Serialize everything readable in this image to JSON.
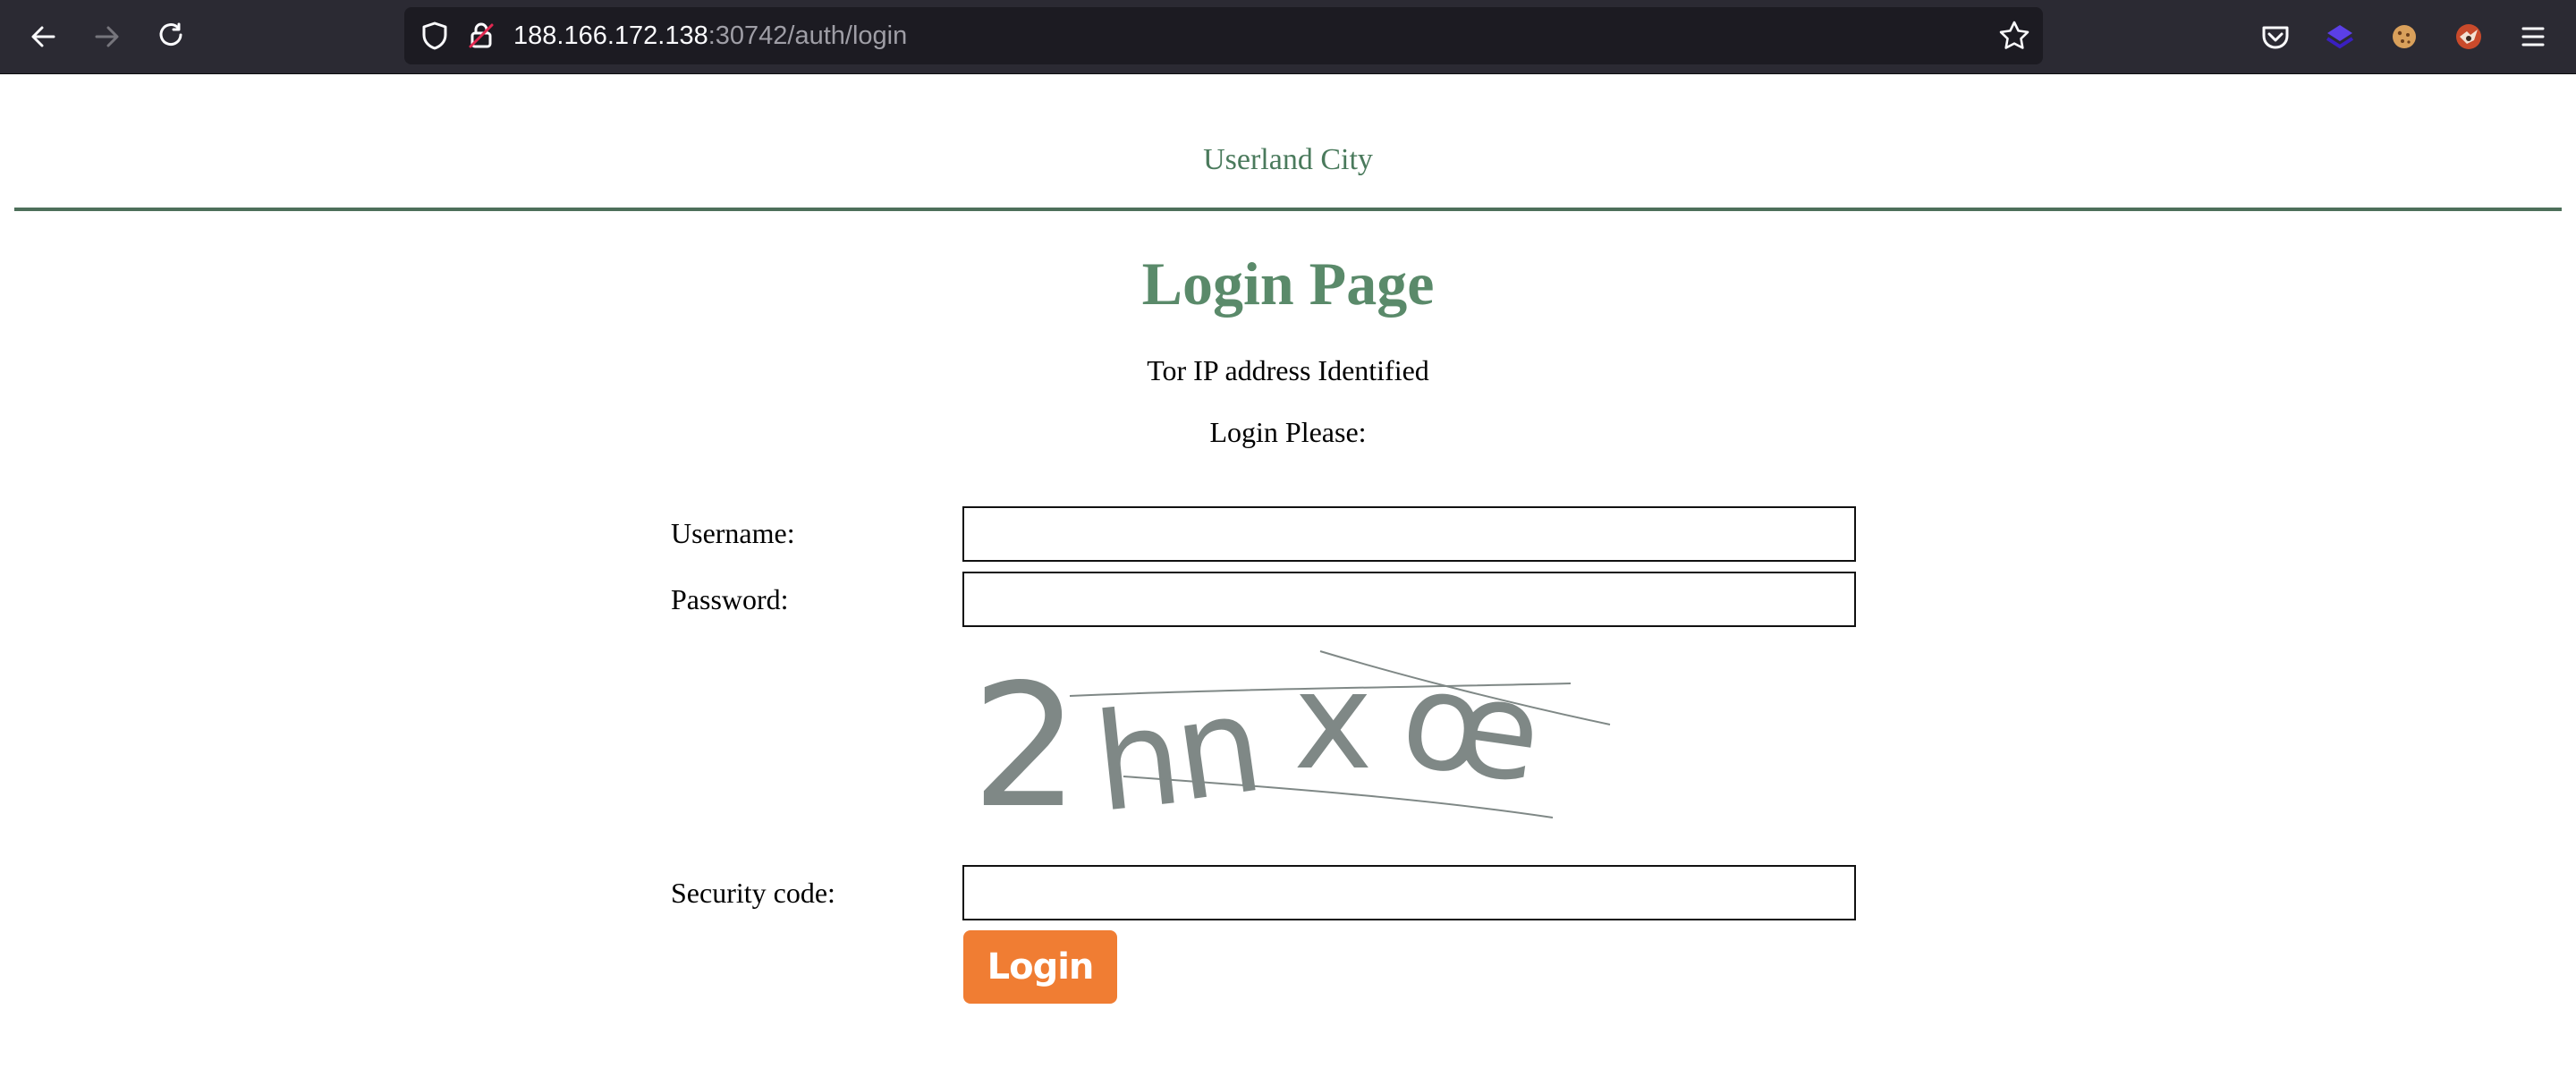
{
  "browser": {
    "url_host": "188.166.172.138",
    "url_path": ":30742/auth/login",
    "icons": [
      "back-arrow-icon",
      "forward-arrow-icon",
      "reload-icon",
      "shield-icon",
      "insecure-lock-icon",
      "star-icon",
      "pocket-icon",
      "extension-layers-icon",
      "cookie-icon",
      "fox-avatar-icon",
      "menu-icon"
    ],
    "colors": {
      "toolbar": "#2b2a33",
      "urlbar": "#1c1b22"
    }
  },
  "header": {
    "site_name": "Userland City"
  },
  "main": {
    "title": "Login Page",
    "notice": "Tor IP address Identified",
    "prompt": "Login Please:"
  },
  "form": {
    "username_label": "Username:",
    "username_value": "",
    "password_label": "Password:",
    "password_value": "",
    "security_code_label": "Security code:",
    "security_code_value": "",
    "captcha_text": "2hnxœ",
    "login_label": "Login"
  },
  "colors": {
    "accent_green": "#5a8a6a",
    "rule_green": "#4d6f5a",
    "button_orange": "#f07d33",
    "captcha_gray": "#7f8886"
  }
}
